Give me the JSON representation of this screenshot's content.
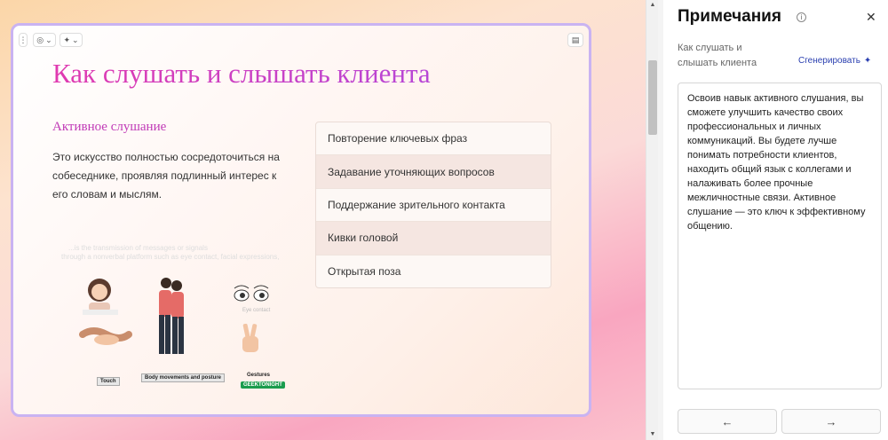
{
  "slide": {
    "title": "Как слушать и слышать клиента",
    "subheading": "Активное слушание",
    "body": "Это искусство полностью сосредоточиться на собеседнике, проявляя подлинный интерес к его словам и мыслям.",
    "list_items": [
      "Повторение ключевых фраз",
      "Задавание уточняющих вопросов",
      "Поддержание зрительного контакта",
      "Кивки головой",
      "Открытая поза"
    ],
    "illustration": {
      "faded_line_1": "...is the transmission of messages or signals",
      "faded_line_2": "through a nonverbal platform such as eye contact, facial expressions,",
      "label_touch": "Touch",
      "label_body": "Body movements and posture",
      "label_gestures": "Gestures",
      "label_eye": "Eye contact",
      "logo": "GEEKTONIGHT"
    }
  },
  "toolbar": {
    "menu_icon": "vertical-dots-icon",
    "theme_icon": "palette-icon",
    "ai_icon": "sparkle-icon",
    "notes_icon": "document-icon"
  },
  "notes_panel": {
    "title": "Примечания",
    "slide_name": "Как слушать и слышать клиента",
    "generate_label": "Сгенерировать",
    "notes_text": "Освоив навык активного слушания, вы сможете улучшить качество своих профессиональных и личных коммуникаций. Вы будете лучше понимать потребности клиентов, находить общий язык с коллегами и налаживать более прочные межличностные связи. Активное слушание — это ключ к эффективному общению.",
    "prev_label": "←",
    "next_label": "→"
  },
  "colors": {
    "title_gradient_start": "#e03ab0",
    "title_gradient_end": "#b746d6",
    "slide_border": "#c9b3f2",
    "generate_link": "#2a3fb0"
  }
}
